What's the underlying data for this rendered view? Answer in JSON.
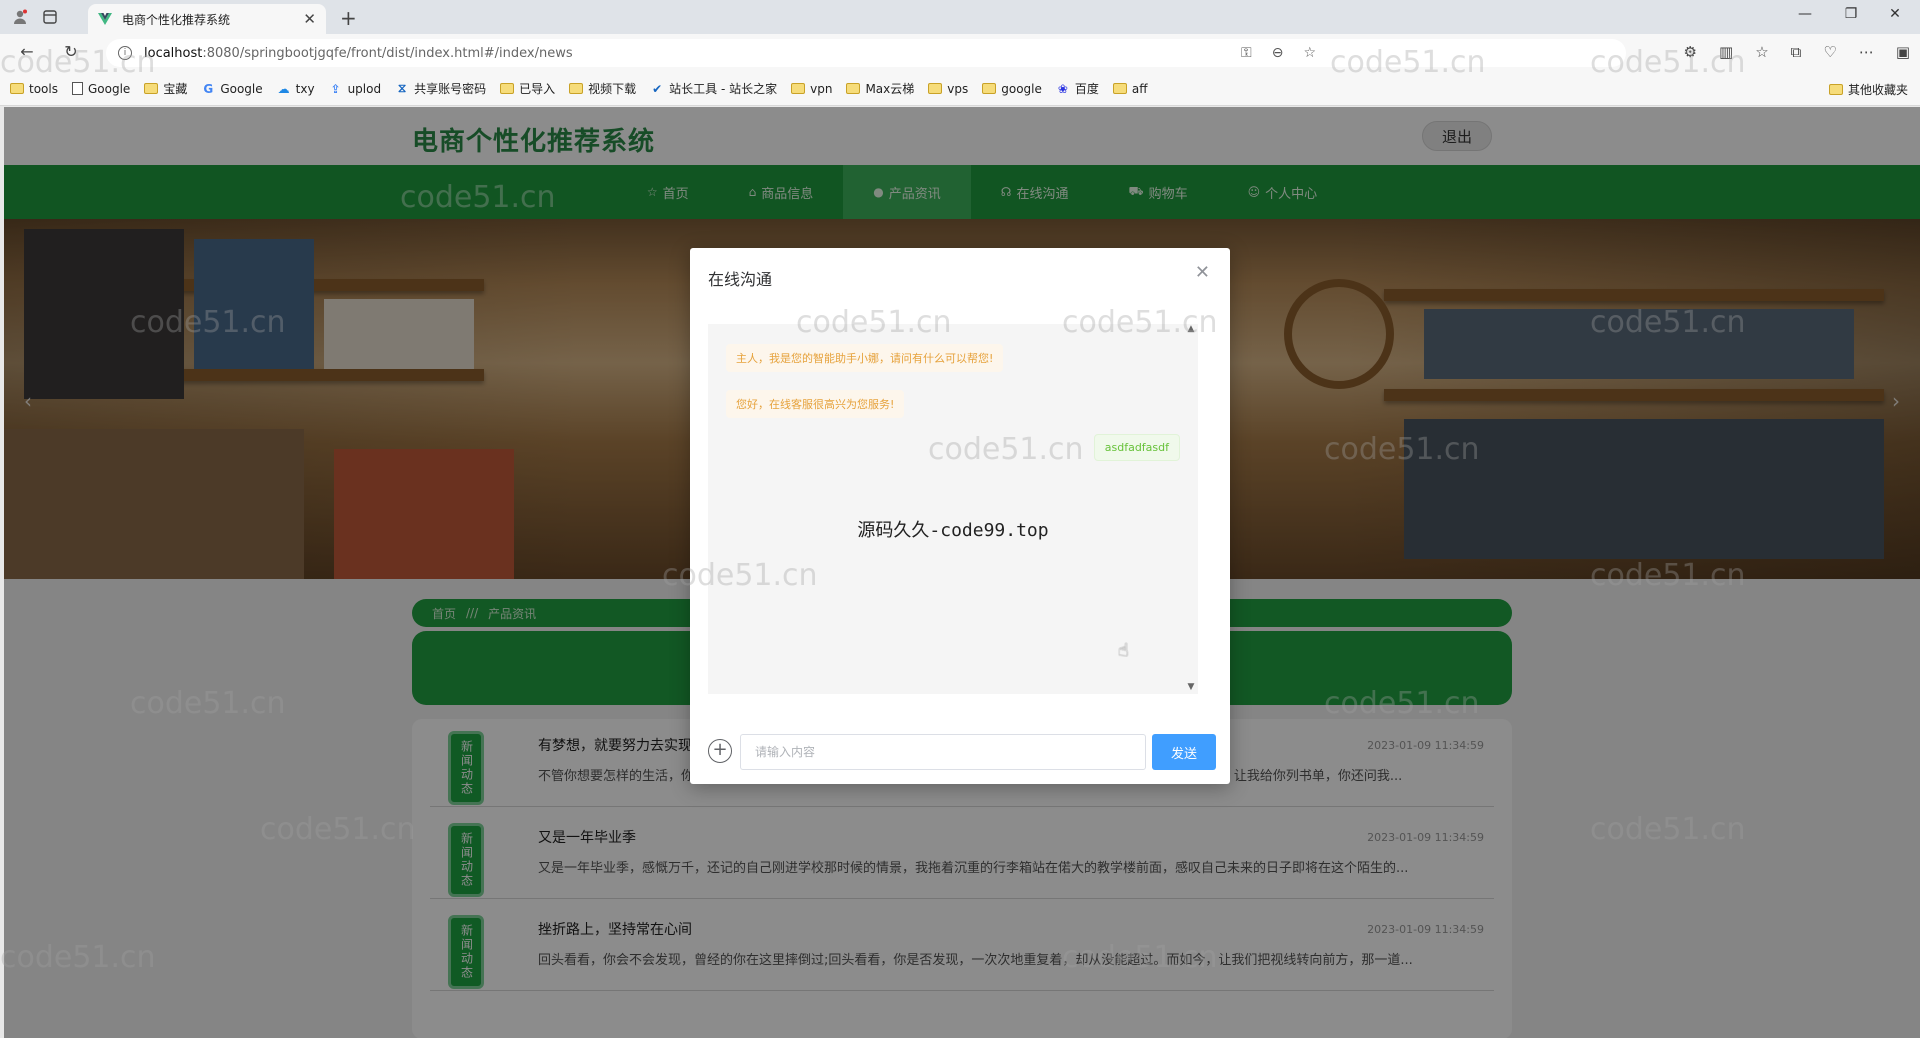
{
  "browser": {
    "tab_title": "电商个性化推荐系统",
    "url_host": "localhost",
    "url_path": ":8080/springbootjgqfe/front/dist/index.html#/index/news",
    "bookmarks": [
      "tools",
      "Google",
      "宝藏",
      "Google",
      "txy",
      "uplod",
      "共享账号密码",
      "已导入",
      "视频下载",
      "站长工具 - 站长之家",
      "vpn",
      "Max云梯",
      "vps",
      "google",
      "百度",
      "aff"
    ],
    "bookmarks_other": "其他收藏夹"
  },
  "site": {
    "title": "电商个性化推荐系统",
    "logout": "退出",
    "nav": [
      {
        "label": "首页",
        "icon": "home-icon"
      },
      {
        "label": "商品信息",
        "icon": "bag-icon"
      },
      {
        "label": "产品资讯",
        "icon": "info-icon"
      },
      {
        "label": "在线沟通",
        "icon": "headset-icon"
      },
      {
        "label": "购物车",
        "icon": "cart-icon"
      },
      {
        "label": "个人中心",
        "icon": "user-icon"
      }
    ],
    "active_nav": "产品资讯",
    "breadcrumb": {
      "home": "首页",
      "sep": "///",
      "current": "产品资讯"
    }
  },
  "news": [
    {
      "badge": "新闻动态",
      "title": "有梦想，就要努力去实现",
      "date": "2023-01-09 11:34:59",
      "desc": "不管你想要怎样的生活，你都要去努力争取，不多尝试一些事情怎么知道自己适合什么、不适合什么呢?你说你喜欢读书，让我给你列书单，你还问我..."
    },
    {
      "badge": "新闻动态",
      "title": "又是一年毕业季",
      "date": "2023-01-09 11:34:59",
      "desc": "又是一年毕业季，感慨万千，还记的自己刚进学校那时候的情景，我拖着沉重的行李箱站在偌大的教学楼前面，感叹自己未来的日子即将在这个陌生的..."
    },
    {
      "badge": "新闻动态",
      "title": "挫折路上，坚持常在心间",
      "date": "2023-01-09 11:34:59",
      "desc": "回头看看，你会不会发现，曾经的你在这里摔倒过;回头看看，你是否发现，一次次地重复着，却从没能超过。而如今，让我们把视线转向前方，那一道..."
    }
  ],
  "chat": {
    "title": "在线沟通",
    "messages": [
      {
        "side": "left",
        "text": "主人，我是您的智能助手小娜，请问有什么可以帮您!"
      },
      {
        "side": "left",
        "text": "您好，在线客服很高兴为您服务!"
      },
      {
        "side": "right",
        "text": "asdfadfasdf"
      }
    ],
    "center_text": "源码久久-code99.top",
    "input_placeholder": "请输入内容",
    "send_label": "发送"
  },
  "watermark": "code51.cn"
}
